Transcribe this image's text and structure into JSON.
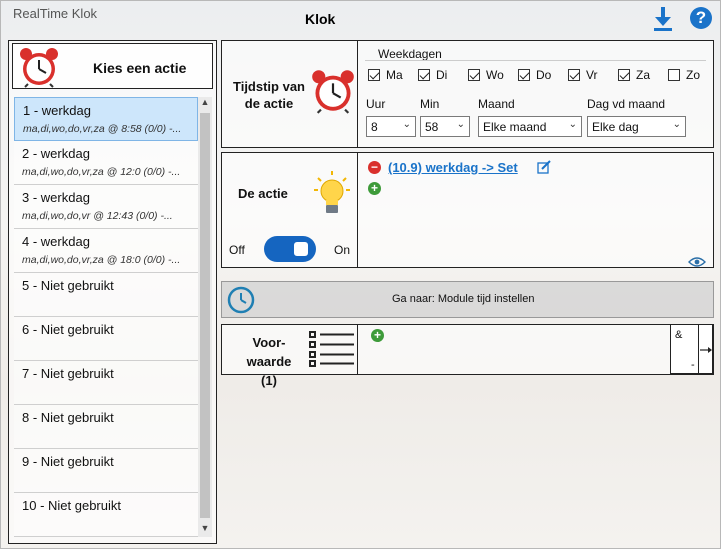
{
  "app": {
    "title": "RealTime Klok",
    "page_title": "Klok",
    "help": "?"
  },
  "left": {
    "header": "Kies een actie",
    "items": [
      {
        "name": "1 - werkdag",
        "sub": "ma,di,wo,do,vr,za @ 8:58 (0/0) -...",
        "selected": true
      },
      {
        "name": "2 - werkdag",
        "sub": "ma,di,wo,do,vr,za @ 12:0 (0/0) -..."
      },
      {
        "name": "3 - werkdag",
        "sub": "ma,di,wo,do,vr @ 12:43 (0/0) -..."
      },
      {
        "name": "4 - werkdag",
        "sub": "ma,di,wo,do,vr,za @ 18:0 (0/0) -..."
      },
      {
        "name": "5 - Niet gebruikt",
        "sub": ""
      },
      {
        "name": "6 - Niet gebruikt",
        "sub": ""
      },
      {
        "name": "7 - Niet gebruikt",
        "sub": ""
      },
      {
        "name": "8 - Niet gebruikt",
        "sub": ""
      },
      {
        "name": "9 - Niet gebruikt",
        "sub": ""
      },
      {
        "name": "10 - Niet gebruikt",
        "sub": ""
      }
    ]
  },
  "tijdstip": {
    "label": "Tijdstip van de actie",
    "weekdagen_title": "Weekdagen",
    "days": [
      {
        "label": "Ma",
        "checked": true
      },
      {
        "label": "Di",
        "checked": true
      },
      {
        "label": "Wo",
        "checked": true
      },
      {
        "label": "Do",
        "checked": true
      },
      {
        "label": "Vr",
        "checked": true
      },
      {
        "label": "Za",
        "checked": true
      },
      {
        "label": "Zo",
        "checked": false
      }
    ],
    "uur_label": "Uur",
    "uur_value": "8",
    "min_label": "Min",
    "min_value": "58",
    "maand_label": "Maand",
    "maand_value": "Elke maand",
    "dag_label": "Dag vd maand",
    "dag_value": "Elke dag"
  },
  "actie": {
    "label": "De actie",
    "off": "Off",
    "on": "On",
    "enabled": true,
    "link": "(10.9) werkdag -> Set"
  },
  "ganaar": {
    "label": "Ga naar: Module tijd instellen"
  },
  "voorwaarde": {
    "label": "Voor-waarde (1)",
    "gate": "&",
    "gate_dash": "-"
  },
  "colors": {
    "accent": "#1a73c9",
    "toggle": "#1565c0",
    "remove": "#d9302c",
    "add": "#3e9b3a",
    "selected_row": "#cde6fb"
  }
}
